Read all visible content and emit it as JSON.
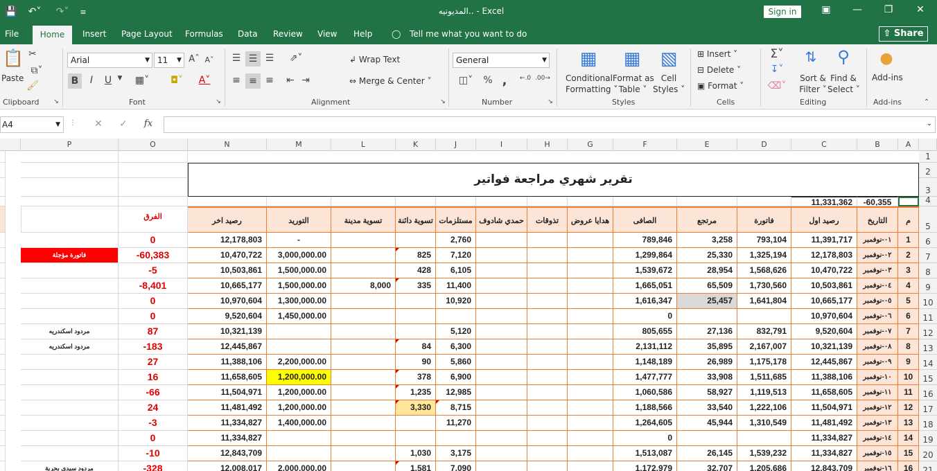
{
  "titlebar": {
    "title": "المديونيه..  -  Excel",
    "signin": "Sign in"
  },
  "tabs": [
    "File",
    "Home",
    "Insert",
    "Page Layout",
    "Formulas",
    "Data",
    "Review",
    "View",
    "Help"
  ],
  "tell_me": "Tell me what you want to do",
  "share": "Share",
  "ribbon": {
    "clipboard": {
      "label": "Clipboard",
      "paste": "Paste"
    },
    "font": {
      "label": "Font",
      "name": "Arial",
      "size": "11",
      "bold": "B",
      "italic": "I",
      "underline": "U"
    },
    "alignment": {
      "label": "Alignment",
      "wrap": "Wrap Text",
      "merge": "Merge & Center"
    },
    "number": {
      "label": "Number",
      "format": "General",
      "percent": "%",
      "comma": ","
    },
    "styles": {
      "label": "Styles",
      "conditional": "Conditional",
      "formatting": "Formatting",
      "format_as": "Format as",
      "table": "Table",
      "cell": "Cell",
      "styles": "Styles"
    },
    "cells": {
      "label": "Cells",
      "insert": "Insert",
      "delete": "Delete",
      "format": "Format"
    },
    "editing": {
      "label": "Editing",
      "sort": "Sort &",
      "filter": "Filter",
      "find": "Find &",
      "select": "Select"
    },
    "addins": {
      "label": "Add-ins",
      "btn": "Add-ins"
    }
  },
  "formula_bar": {
    "name_box": "A4",
    "fx": "fx",
    "value": ""
  },
  "columns": [
    "P",
    "O",
    "N",
    "M",
    "L",
    "K",
    "J",
    "I",
    "H",
    "G",
    "F",
    "E",
    "D",
    "C",
    "B",
    "A"
  ],
  "sheet": {
    "title": "تقرير شهري مراجعة فواتير",
    "row4": {
      "C": "11,331,362",
      "B": "-60,355"
    },
    "headers": {
      "O": "الفرق",
      "N": "رصيد اخر",
      "M": "التوريد",
      "L": "تسوية مدينة",
      "K": "تسوية دائنة",
      "J": "مستلزمات",
      "I": "حمدي شادوف",
      "H": "تذوقات",
      "G": "هدايا عروض",
      "F": "الصافى",
      "E": "مرتجع",
      "D": "فاتورة",
      "C": "رصيد اول",
      "B": "التاريخ",
      "A": "م"
    },
    "rows": [
      {
        "r": "6",
        "A": "1",
        "B": "٠١-نوفمبر",
        "C": "11,391,717",
        "D": "793,104",
        "E": "3,258",
        "F": "789,846",
        "J": "2,760",
        "K": "",
        "L": "",
        "M": "-",
        "N": "12,178,803",
        "O": "0",
        "P": ""
      },
      {
        "r": "7",
        "A": "2",
        "B": "٠٢-نوفمبر",
        "C": "12,178,803",
        "D": "1,325,194",
        "E": "25,330",
        "F": "1,299,864",
        "J": "7,120",
        "K": "825",
        "L": "",
        "M": "3,000,000.00",
        "N": "10,470,722",
        "O": "-60,383",
        "P": "فاتورة مؤجلة"
      },
      {
        "r": "8",
        "A": "3",
        "B": "٠٣-نوفمبر",
        "C": "10,470,722",
        "D": "1,568,626",
        "E": "28,954",
        "F": "1,539,672",
        "J": "6,105",
        "K": "428",
        "L": "",
        "M": "1,500,000.00",
        "N": "10,503,861",
        "O": "-5",
        "P": ""
      },
      {
        "r": "9",
        "A": "4",
        "B": "٠٤-نوفمبر",
        "C": "10,503,861",
        "D": "1,730,560",
        "E": "65,509",
        "F": "1,665,051",
        "J": "11,400",
        "K": "335",
        "L": "8,000",
        "M": "1,500,000.00",
        "N": "10,665,177",
        "O": "-8,401",
        "P": ""
      },
      {
        "r": "10",
        "A": "5",
        "B": "٠٥-نوفمبر",
        "C": "10,665,177",
        "D": "1,641,804",
        "E": "25,457",
        "F": "1,616,347",
        "J": "10,920",
        "K": "",
        "L": "",
        "M": "1,300,000.00",
        "N": "10,970,604",
        "O": "0",
        "P": ""
      },
      {
        "r": "11",
        "A": "6",
        "B": "٠٦-نوفمبر",
        "C": "10,970,604",
        "D": "",
        "E": "",
        "F": "0",
        "J": "",
        "K": "",
        "L": "",
        "M": "1,450,000.00",
        "N": "9,520,604",
        "O": "0",
        "P": ""
      },
      {
        "r": "12",
        "A": "7",
        "B": "٠٧-نوفمبر",
        "C": "9,520,604",
        "D": "832,791",
        "E": "27,136",
        "F": "805,655",
        "J": "5,120",
        "K": "",
        "L": "",
        "M": "",
        "N": "10,321,139",
        "O": "87",
        "P": "مردود اسكندريه"
      },
      {
        "r": "13",
        "A": "8",
        "B": "٠٨-نوفمبر",
        "C": "10,321,139",
        "D": "2,167,007",
        "E": "35,895",
        "F": "2,131,112",
        "J": "6,300",
        "K": "84",
        "L": "",
        "M": "",
        "N": "12,445,867",
        "O": "-183",
        "P": "مردود اسكندريه"
      },
      {
        "r": "14",
        "A": "9",
        "B": "٠٩-نوفمبر",
        "C": "12,445,867",
        "D": "1,175,178",
        "E": "26,989",
        "F": "1,148,189",
        "J": "5,860",
        "K": "90",
        "L": "",
        "M": "2,200,000.00",
        "N": "11,388,106",
        "O": "27",
        "P": ""
      },
      {
        "r": "15",
        "A": "10",
        "B": "١٠-نوفمبر",
        "C": "11,388,106",
        "D": "1,511,685",
        "E": "33,908",
        "F": "1,477,777",
        "J": "6,900",
        "K": "378",
        "L": "",
        "M": "1,200,000.00",
        "N": "11,658,605",
        "O": "16",
        "P": ""
      },
      {
        "r": "16",
        "A": "11",
        "B": "١١-نوفمبر",
        "C": "11,658,605",
        "D": "1,119,513",
        "E": "58,927",
        "F": "1,060,586",
        "J": "12,985",
        "K": "1,235",
        "L": "",
        "M": "1,200,000.00",
        "N": "11,504,971",
        "O": "-66",
        "P": ""
      },
      {
        "r": "17",
        "A": "12",
        "B": "١٢-نوفمبر",
        "C": "11,504,971",
        "D": "1,222,106",
        "E": "33,540",
        "F": "1,188,566",
        "J": "8,715",
        "K": "3,330",
        "L": "",
        "M": "1,200,000.00",
        "N": "11,481,492",
        "O": "24",
        "P": ""
      },
      {
        "r": "18",
        "A": "13",
        "B": "١٣-نوفمبر",
        "C": "11,481,492",
        "D": "1,310,549",
        "E": "45,944",
        "F": "1,264,605",
        "J": "11,270",
        "K": "",
        "L": "",
        "M": "1,400,000.00",
        "N": "11,334,827",
        "O": "-3",
        "P": ""
      },
      {
        "r": "19",
        "A": "14",
        "B": "١٤-نوفمبر",
        "C": "11,334,827",
        "D": "",
        "E": "",
        "F": "0",
        "J": "",
        "K": "",
        "L": "",
        "M": "",
        "N": "11,334,827",
        "O": "0",
        "P": ""
      },
      {
        "r": "20",
        "A": "15",
        "B": "١٥-نوفمبر",
        "C": "11,334,827",
        "D": "1,539,232",
        "E": "26,145",
        "F": "1,513,087",
        "J": "3,175",
        "K": "1,030",
        "L": "",
        "M": "",
        "N": "12,843,709",
        "O": "-10",
        "P": ""
      },
      {
        "r": "21",
        "A": "16",
        "B": "١٦-نوفمبر",
        "C": "12,843,709",
        "D": "1,205,686",
        "E": "32,707",
        "F": "1,172,979",
        "J": "7,090",
        "K": "1,581",
        "L": "",
        "M": "2,000,000.00",
        "N": "12,008,017",
        "O": "-328",
        "P": "مردود سيدي بحرية"
      }
    ],
    "highlights": {
      "M15": "#ffff00",
      "E10": "#d9d9d9",
      "K17": "#ffe699",
      "P7": "#ff0000"
    }
  }
}
